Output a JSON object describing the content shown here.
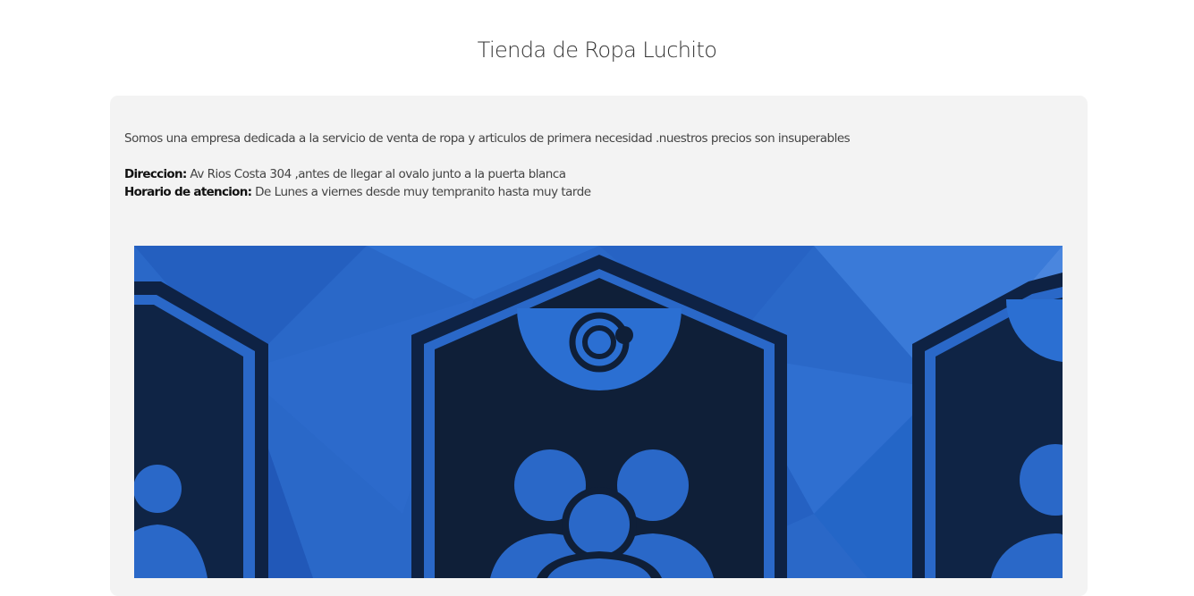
{
  "page": {
    "title": "Tienda de Ropa Luchito"
  },
  "about": {
    "description": "Somos una empresa dedicada a la servicio de venta de ropa y articulos de primera necesidad .nuestros precios son insuperables",
    "address_label": "Direccion:",
    "address_value": " Av Rios Costa 304 ,antes de llegar al ovalo junto a la puerta blanca",
    "hours_label": "Horario de atencion:",
    "hours_value": " De Lunes a viernes desde muy tempranito hasta muy tarde"
  },
  "banner": {
    "image": "team-shields-illustration",
    "colors": {
      "background": "#2a68c8",
      "shield_fill": "#0f1f38",
      "shield_border": "#0e2244",
      "accent": "#1e5bb8"
    }
  }
}
